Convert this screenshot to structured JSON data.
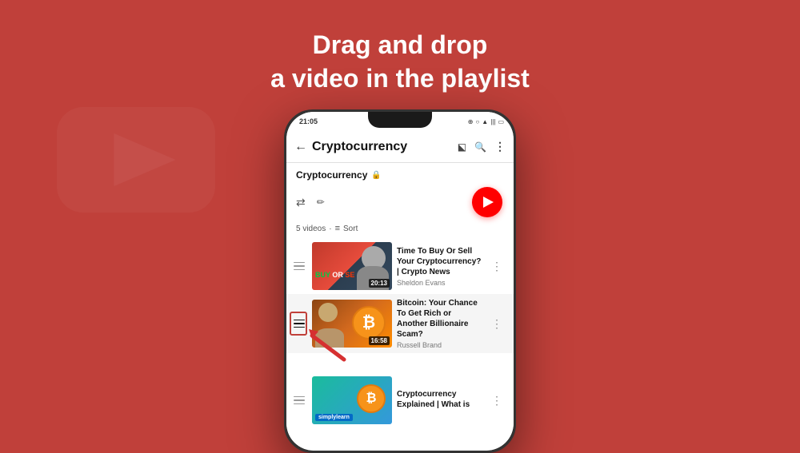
{
  "background": {
    "color": "#c0403a"
  },
  "header": {
    "line1": "Drag and drop",
    "line2": "a video in the playlist"
  },
  "status_bar": {
    "time": "21:05",
    "icons": "⊕ ○ ⬡ ◷ ∿ ▲"
  },
  "app_bar": {
    "back_icon": "←",
    "title": "Cryptocurrency",
    "cast_icon": "⬕",
    "search_icon": "🔍",
    "more_icon": "⋮"
  },
  "playlist": {
    "title": "Cryptocurrency",
    "lock_icon": "🔒",
    "shuffle_icon": "⇌",
    "edit_icon": "✏",
    "video_count": "5 videos",
    "sort_icon": "≡",
    "sort_label": "Sort"
  },
  "videos": [
    {
      "id": 1,
      "title": "Time To Buy Or Sell Your Cryptocurrency? | Crypto News",
      "channel": "Sheldon Evans",
      "duration": "20:13",
      "thumb_type": "red"
    },
    {
      "id": 2,
      "title": "Bitcoin: Your Chance To Get Rich or Another Billionaire Scam?",
      "channel": "Russell Brand",
      "duration": "16:58",
      "thumb_type": "bitcoin",
      "highlighted": true
    },
    {
      "id": 3,
      "title": "Cryptocurrency Explained | What is",
      "channel": "",
      "duration": "",
      "thumb_type": "teal"
    }
  ],
  "arrow": {
    "label": "drag handle indicator arrow"
  }
}
